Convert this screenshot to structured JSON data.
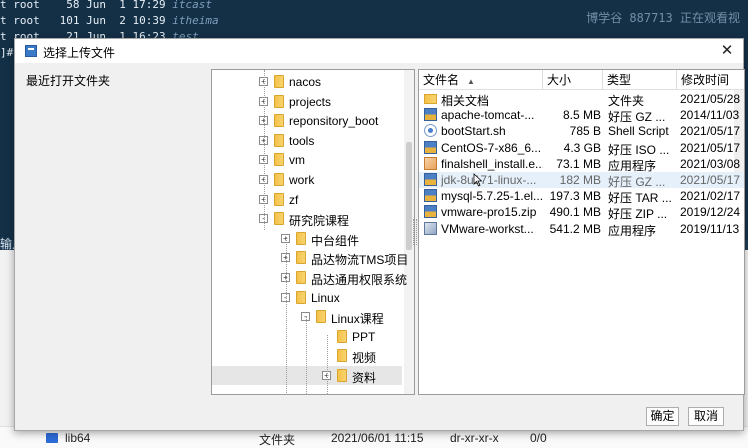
{
  "terminal": {
    "lines": [
      {
        "left": "t root",
        "num": "58",
        "mon": "Jun",
        "day": "1",
        "time": "17:29",
        "name": "itcast"
      },
      {
        "left": "t root",
        "num": "101",
        "mon": "Jun",
        "day": "2",
        "time": "10:39",
        "name": "itheima"
      },
      {
        "left": "t root",
        "num": "21",
        "mon": "Jun",
        "day": "1",
        "time": "16:23",
        "name": "test"
      }
    ],
    "prompt": "]#",
    "watermark": "博学谷 887713 正在观看视",
    "side_label": "输入"
  },
  "bottom_row": {
    "name": "lib64",
    "type": "文件夹",
    "date": "2021/06/01 11:15",
    "perm": "dr-xr-xr-x",
    "owner": "0/0"
  },
  "dialog": {
    "title": "选择上传文件",
    "close": "✕",
    "recent_label": "最近打开文件夹",
    "ok_label": "确定",
    "cancel_label": "取消"
  },
  "tree": [
    {
      "label": "nacos",
      "expander": "+",
      "level": 0
    },
    {
      "label": "projects",
      "expander": "+",
      "level": 0
    },
    {
      "label": "reponsitory_boot",
      "expander": "+",
      "level": 0
    },
    {
      "label": "tools",
      "expander": "+",
      "level": 0
    },
    {
      "label": "vm",
      "expander": "+",
      "level": 0
    },
    {
      "label": "work",
      "expander": "+",
      "level": 0
    },
    {
      "label": "zf",
      "expander": "+",
      "level": 0
    },
    {
      "label": "研究院课程",
      "expander": "-",
      "level": 0
    },
    {
      "label": "中台组件",
      "expander": "+",
      "level": 1
    },
    {
      "label": "品达物流TMS项目",
      "expander": "+",
      "level": 1
    },
    {
      "label": "品达通用权限系统",
      "expander": "+",
      "level": 1
    },
    {
      "label": "Linux",
      "expander": "-",
      "level": 1
    },
    {
      "label": "Linux课程",
      "expander": "-",
      "level": 2
    },
    {
      "label": "PPT",
      "expander": "",
      "level": 3
    },
    {
      "label": "视频",
      "expander": "",
      "level": 3
    },
    {
      "label": "资料",
      "expander": "+",
      "level": 3,
      "selected": true
    }
  ],
  "columns": {
    "name": "文件名",
    "size": "大小",
    "type": "类型",
    "date": "修改时间",
    "sort_arrow": "▲"
  },
  "files": [
    {
      "icon": "folder",
      "name": "相关文档",
      "size": "",
      "type": "文件夹",
      "date": "2021/05/28"
    },
    {
      "icon": "archive",
      "name": "apache-tomcat-...",
      "size": "8.5 MB",
      "type": "好压 GZ ...",
      "date": "2014/11/03"
    },
    {
      "icon": "sh",
      "name": "bootStart.sh",
      "size": "785 B",
      "type": "Shell Script",
      "date": "2021/05/17"
    },
    {
      "icon": "archive",
      "name": "CentOS-7-x86_6...",
      "size": "4.3 GB",
      "type": "好压 ISO ...",
      "date": "2021/05/17"
    },
    {
      "icon": "exe",
      "name": "finalshell_install.e...",
      "size": "73.1 MB",
      "type": "应用程序",
      "date": "2021/03/08"
    },
    {
      "icon": "archive",
      "name": "jdk-8u171-linux-...",
      "size": "182 MB",
      "type": "好压 GZ ...",
      "date": "2021/05/17",
      "hover": true
    },
    {
      "icon": "archive",
      "name": "mysql-5.7.25-1.el...",
      "size": "197.3 MB",
      "type": "好压 TAR ...",
      "date": "2021/02/17"
    },
    {
      "icon": "archive",
      "name": "vmware-pro15.zip",
      "size": "490.1 MB",
      "type": "好压 ZIP ...",
      "date": "2019/12/24"
    },
    {
      "icon": "vm",
      "name": "VMware-workst...",
      "size": "541.2 MB",
      "type": "应用程序",
      "date": "2019/11/13"
    }
  ]
}
